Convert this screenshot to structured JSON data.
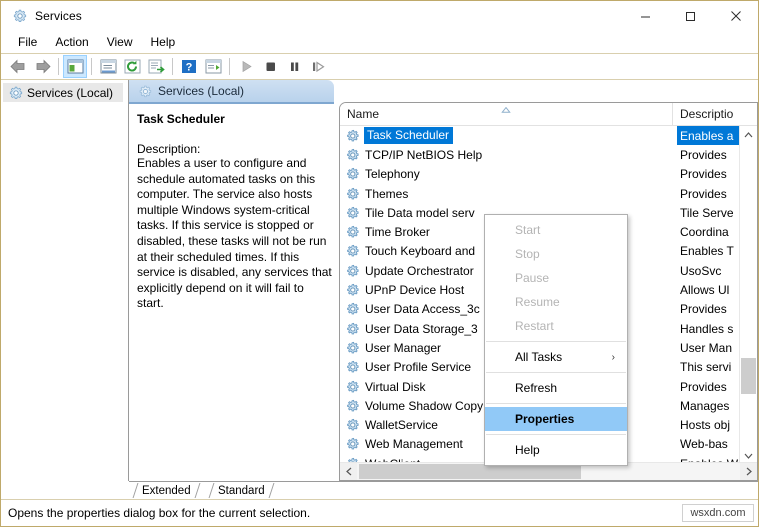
{
  "window": {
    "title": "Services",
    "icon": "services-gear-icon",
    "controls": {
      "minimize": "–",
      "maximize": "□",
      "close": "×"
    }
  },
  "menubar": {
    "items": [
      {
        "label": "File",
        "name": "menu-file"
      },
      {
        "label": "Action",
        "name": "menu-action"
      },
      {
        "label": "View",
        "name": "menu-view"
      },
      {
        "label": "Help",
        "name": "menu-help"
      }
    ]
  },
  "toolbar": {
    "buttons": [
      {
        "name": "back-icon",
        "glyph": "⬅"
      },
      {
        "name": "forward-icon",
        "glyph": "➡"
      },
      {
        "name": "show-hide-console-tree-icon",
        "glyph": "tree-pane"
      },
      {
        "name": "properties-icon",
        "glyph": "props"
      },
      {
        "name": "refresh-icon",
        "glyph": "refresh"
      },
      {
        "name": "export-list-icon",
        "glyph": "export"
      },
      {
        "name": "help-icon",
        "glyph": "?"
      },
      {
        "name": "show-hide-action-pane-icon",
        "glyph": "action-pane"
      },
      {
        "name": "start-service-icon",
        "glyph": "▶"
      },
      {
        "name": "stop-service-icon",
        "glyph": "■"
      },
      {
        "name": "pause-service-icon",
        "glyph": "‖"
      },
      {
        "name": "restart-service-icon",
        "glyph": "▶|"
      }
    ]
  },
  "tree": {
    "root_label": "Services (Local)",
    "root_icon": "services-gear-icon"
  },
  "pane": {
    "tab_label": "Services (Local)",
    "tab_icon": "services-gear-icon"
  },
  "description_panel": {
    "service_title": "Task Scheduler",
    "label": "Description:",
    "text": "Enables a user to configure and schedule automated tasks on this computer. The service also hosts multiple Windows system-critical tasks. If this service is stopped or disabled, these tasks will not be run at their scheduled times. If this service is disabled, any services that explicitly depend on it will fail to start."
  },
  "list": {
    "columns": [
      {
        "label": "Name",
        "name": "column-header-name",
        "sort": "ascending",
        "sort_glyph": "▲"
      },
      {
        "label": "Descriptio",
        "name": "column-header-description"
      }
    ],
    "selected_index": 0,
    "rows": [
      {
        "name": "Task Scheduler",
        "description": "Enables a"
      },
      {
        "name": "TCP/IP NetBIOS Help",
        "description": "Provides"
      },
      {
        "name": "Telephony",
        "description": "Provides"
      },
      {
        "name": "Themes",
        "description": "Provides"
      },
      {
        "name": "Tile Data model serv",
        "description": "Tile Serve"
      },
      {
        "name": "Time Broker",
        "description": "Coordina"
      },
      {
        "name": "Touch Keyboard and",
        "description": "Enables T"
      },
      {
        "name": "Update Orchestrator",
        "description": "UsoSvc"
      },
      {
        "name": "UPnP Device Host",
        "description": "Allows Ul"
      },
      {
        "name": "User Data Access_3c",
        "description": "Provides"
      },
      {
        "name": "User Data Storage_3",
        "description": "Handles s"
      },
      {
        "name": "User Manager",
        "description": "User Man"
      },
      {
        "name": "User Profile Service",
        "description": "This servi"
      },
      {
        "name": "Virtual Disk",
        "description": "Provides"
      },
      {
        "name": "Volume Shadow Copy",
        "description": "Manages"
      },
      {
        "name": "WalletService",
        "description": "Hosts obj"
      },
      {
        "name": "Web Management",
        "description": "Web-bas"
      },
      {
        "name": "WebClient",
        "description": "Enables W"
      }
    ],
    "scrollbar": {
      "up_glyph": "∧",
      "down_glyph": "∨",
      "left_glyph": "‹",
      "right_glyph": "›"
    }
  },
  "context_menu": {
    "items": [
      {
        "label": "Start",
        "state": "disabled",
        "name": "context-menu-start"
      },
      {
        "label": "Stop",
        "state": "disabled",
        "name": "context-menu-stop"
      },
      {
        "label": "Pause",
        "state": "disabled",
        "name": "context-menu-pause"
      },
      {
        "label": "Resume",
        "state": "disabled",
        "name": "context-menu-resume"
      },
      {
        "label": "Restart",
        "state": "disabled",
        "name": "context-menu-restart"
      },
      {
        "type": "separator"
      },
      {
        "label": "All Tasks",
        "state": "submenu",
        "submenu_glyph": "›",
        "name": "context-menu-all-tasks"
      },
      {
        "type": "separator"
      },
      {
        "label": "Refresh",
        "state": "normal",
        "name": "context-menu-refresh"
      },
      {
        "type": "separator"
      },
      {
        "label": "Properties",
        "state": "highlight",
        "name": "context-menu-properties"
      },
      {
        "type": "separator"
      },
      {
        "label": "Help",
        "state": "normal",
        "name": "context-menu-help"
      }
    ]
  },
  "bottom_tabs": [
    {
      "label": "Extended",
      "name": "tab-extended",
      "active": false
    },
    {
      "label": "Standard",
      "name": "tab-standard",
      "active": true
    }
  ],
  "statusbar": {
    "text": "Opens the properties dialog box for the current selection.",
    "watermark": "wsxdn.com"
  },
  "colors": {
    "selection_blue": "#0078d7",
    "menu_highlight": "#91c9f7",
    "window_border": "#bfa96a",
    "pane_tab": "#b9d2ec"
  }
}
